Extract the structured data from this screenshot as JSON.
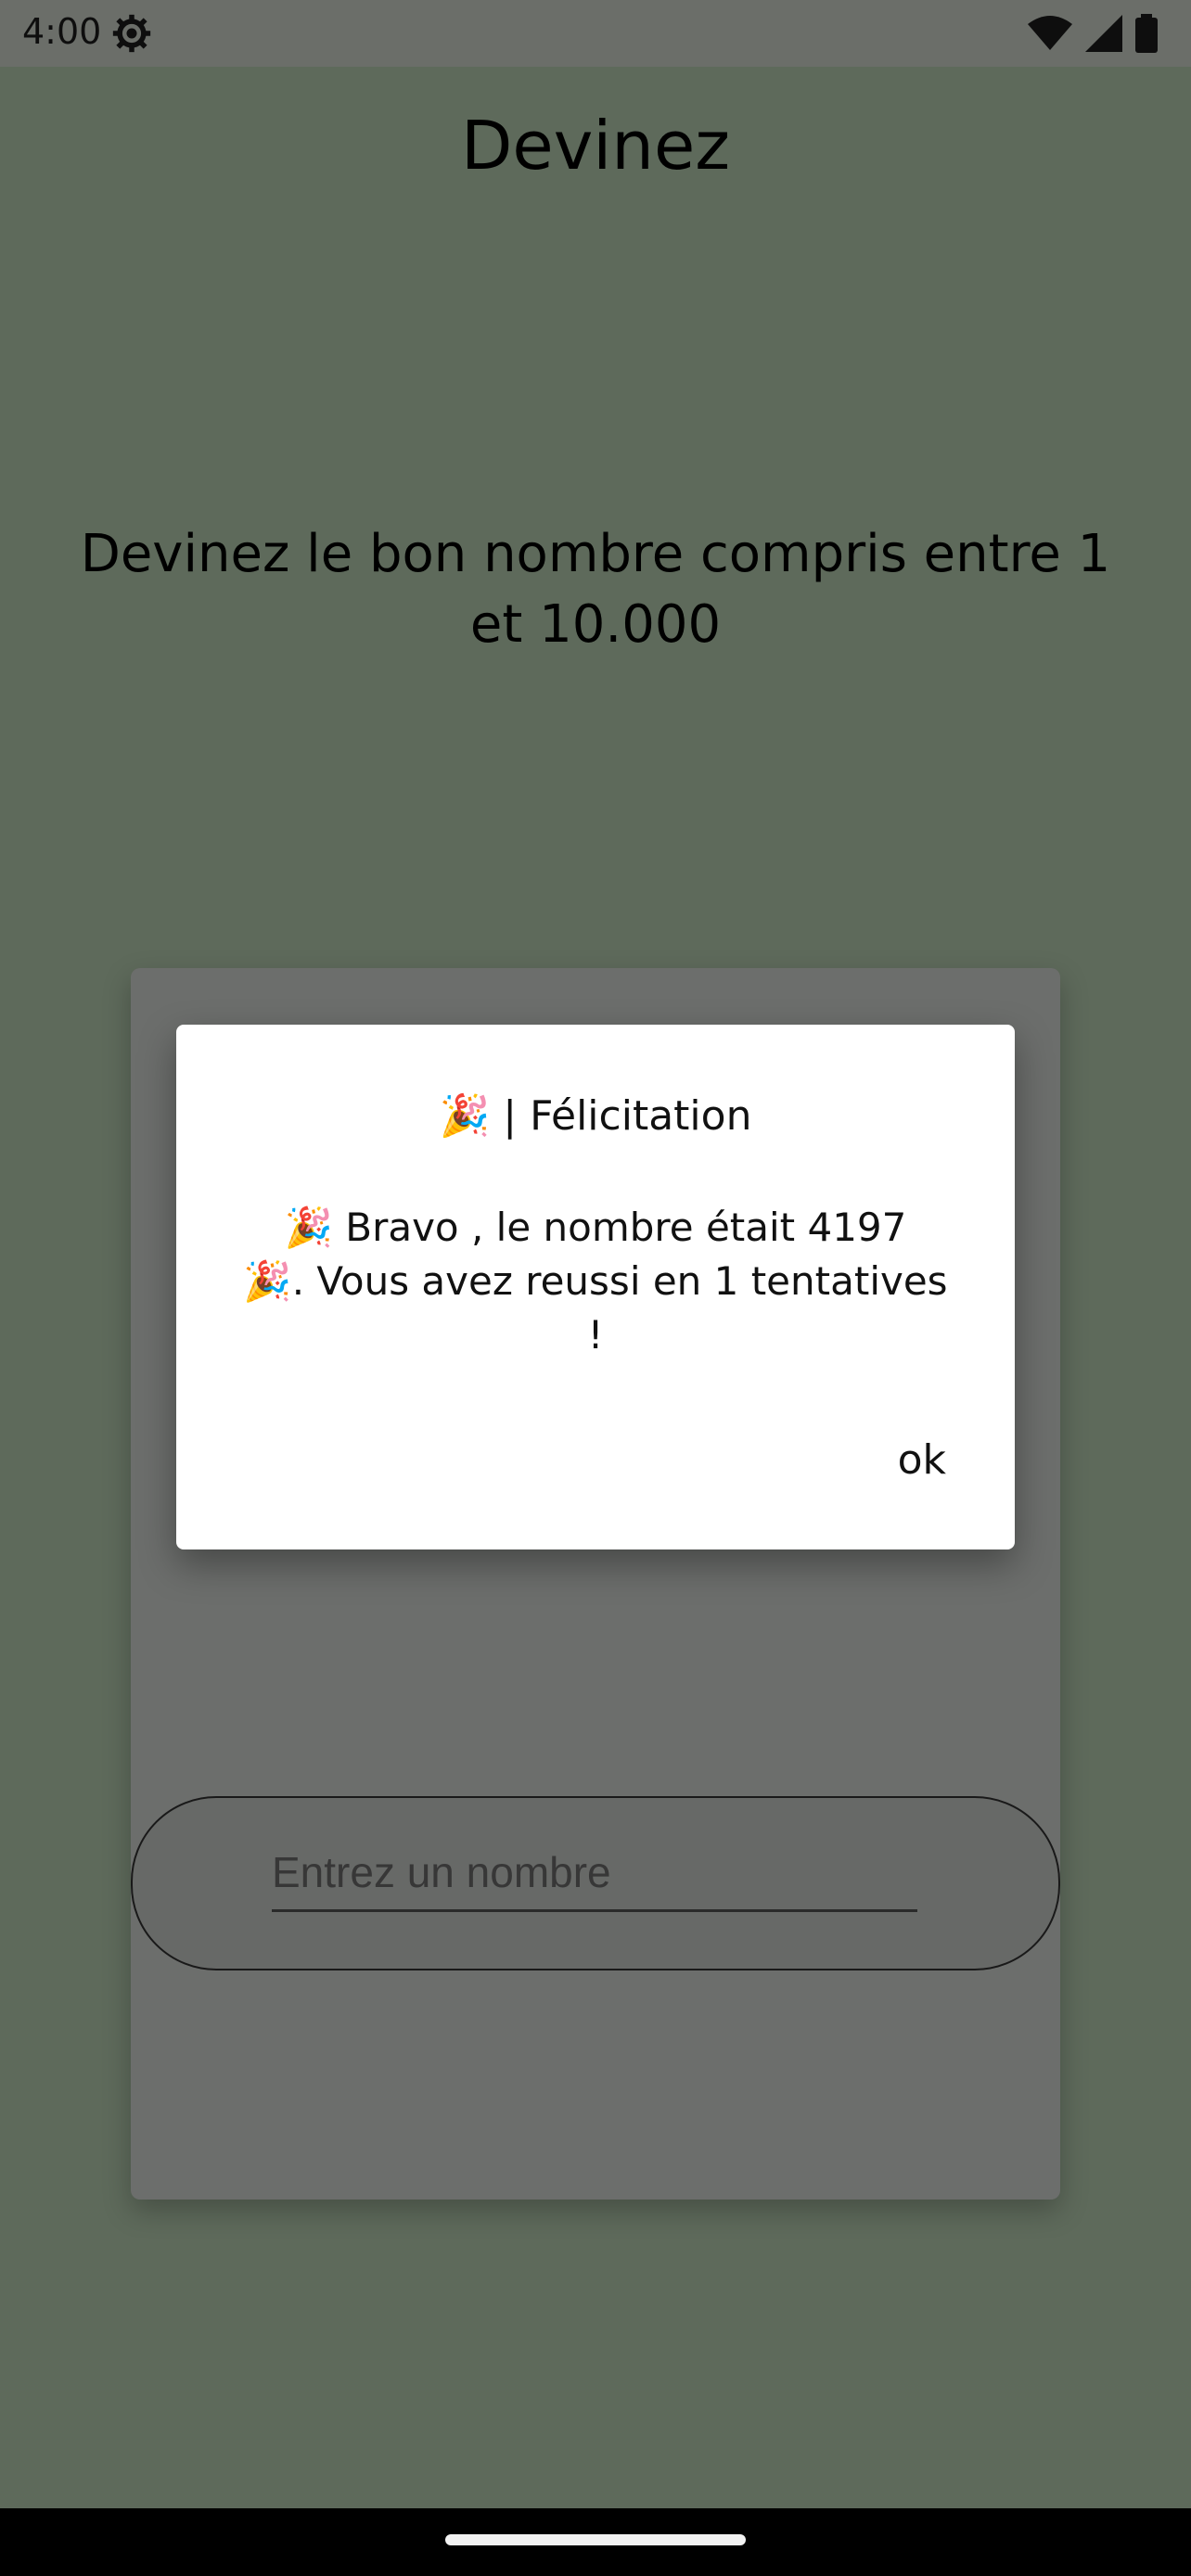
{
  "status_bar": {
    "time": "4:00",
    "icons": [
      "gear-icon",
      "wifi-icon",
      "signal-icon",
      "battery-icon"
    ]
  },
  "app": {
    "title": "Devinez",
    "instruction": "Devinez le bon nombre compris entre 1 et 10.000",
    "guess_input": {
      "placeholder": "Entrez un nombre",
      "value": ""
    }
  },
  "dialog": {
    "title": "🎉 | Félicitation",
    "message_line1": "🎉 Bravo , le nombre était 4197",
    "message_line2": "🎉. Vous avez reussi en 1 tentatives !",
    "ok_label": "ok"
  },
  "colors": {
    "background": "#bcd4b6",
    "card": "#d9dcd8",
    "dialog": "#ffffff",
    "scrim": "rgba(0,0,0,0.5)"
  }
}
